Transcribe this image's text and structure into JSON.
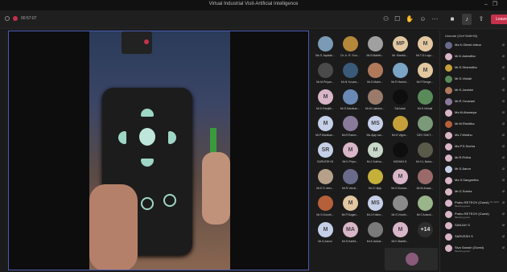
{
  "window": {
    "title": "Virtual Industrial Visit-Artificial Intelligence"
  },
  "toolbar": {
    "timer": "00:57:07",
    "leave_label": "Leave",
    "icons": [
      "people-icon",
      "chat-icon",
      "raise-hand-icon",
      "reactions-icon",
      "more-icon",
      "camera-icon",
      "mic-icon",
      "share-icon"
    ]
  },
  "grid": {
    "tiles": [
      {
        "name": "Ms.S.Jayalak...",
        "initials": "",
        "color": "#7a9ab5"
      },
      {
        "name": "Dr. A. R. Sou...",
        "initials": "",
        "color": "#b5873a"
      },
      {
        "name": "Mr.B.Babith...",
        "initials": "",
        "color": "#a0a0a0"
      },
      {
        "name": "Mr. Manick...",
        "initials": "MP",
        "color": "#e3c7a0"
      },
      {
        "name": "Mr.T.G.Logu...",
        "initials": "M",
        "color": "#e3c7a0"
      },
      {
        "name": "Mr.M.Priyan...",
        "initials": "",
        "color": "#4a4a4a"
      },
      {
        "name": "Mr.N.Yuvara...",
        "initials": "",
        "color": "#3a5a7a"
      },
      {
        "name": "Mr.S.Mahe...",
        "initials": "",
        "color": "#b07a5a"
      },
      {
        "name": "Mr.R.Harish...",
        "initials": "",
        "color": "#7aa5c5"
      },
      {
        "name": "Mr.P.Senge...",
        "initials": "M",
        "color": "#e3c7a0"
      },
      {
        "name": "Mr.K.Ranjith...",
        "initials": "M",
        "color": "#d9b5c8"
      },
      {
        "name": "Mr.S.Sasikum...",
        "initials": "",
        "color": "#6a8ab5"
      },
      {
        "name": "Mr.M.Lakshm...",
        "initials": "",
        "color": "#9a7a6a"
      },
      {
        "name": "Sai kalai",
        "initials": "",
        "color": "#0e0e0e"
      },
      {
        "name": "Mr.S.Vishali",
        "initials": "",
        "color": "#5a8a5a"
      },
      {
        "name": "Mr.P.Manikan...",
        "initials": "M",
        "color": "#c5d0e8"
      },
      {
        "name": "Mr.R.Rame...",
        "initials": "",
        "color": "#8a7a9a"
      },
      {
        "name": "Ms.Ajay sar...",
        "initials": "MS",
        "color": "#c5d0e8"
      },
      {
        "name": "Mr.G.Vigne...",
        "initials": "",
        "color": "#c5a03a"
      },
      {
        "name": "DEV SAKT...",
        "initials": "",
        "color": "#7a9a7a"
      },
      {
        "name": "SARVESH B",
        "initials": "SR",
        "color": "#c5d0e8"
      },
      {
        "name": "Mr.K.Priya...",
        "initials": "M",
        "color": "#d9b5c8"
      },
      {
        "name": "Mr.J.Subha...",
        "initials": "M",
        "color": "#c8d8c8"
      },
      {
        "name": "MOHAN S",
        "initials": "",
        "color": "#0e0e0e"
      },
      {
        "name": "Mr.V.L.Naha...",
        "initials": "",
        "color": "#5a5a4a"
      },
      {
        "name": "Mr.E.S.Jeev...",
        "initials": "",
        "color": "#b5a08a"
      },
      {
        "name": "Mr.R.Vimal...",
        "initials": "",
        "color": "#6a6a8a"
      },
      {
        "name": "Mr.G.Vijay",
        "initials": "",
        "color": "#c5b03a"
      },
      {
        "name": "Mr.G.Kumar...",
        "initials": "M",
        "color": "#d9b5c8"
      },
      {
        "name": "Mr.M.Arasa...",
        "initials": "",
        "color": "#9a6a6a"
      },
      {
        "name": "Mr.S.Gowth...",
        "initials": "",
        "color": "#b5603a"
      },
      {
        "name": "Mr.P.Sugan...",
        "initials": "M",
        "color": "#e3c7a0"
      },
      {
        "name": "Mr.J.Krishn...",
        "initials": "MS",
        "color": "#c5d0e8"
      },
      {
        "name": "Mr.S.Vinoth...",
        "initials": "",
        "color": "#8a8a8a"
      },
      {
        "name": "Mr.T.Anand...",
        "initials": "",
        "color": "#9ab58a"
      },
      {
        "name": "Mr.S.Aaron",
        "initials": "M",
        "color": "#c5d0e8"
      },
      {
        "name": "Mr.S.Karthi...",
        "initials": "MA",
        "color": "#d9b5c8"
      },
      {
        "name": "Mr.K.Ashwi...",
        "initials": "",
        "color": "#7a7a7a"
      },
      {
        "name": "Mr.K.Babith...",
        "initials": "M",
        "color": "#d9b5c8"
      },
      {
        "name": "+14",
        "initials": "+14",
        "color": "#2e2e2e"
      }
    ]
  },
  "panel": {
    "header": "Unmute (Ctrl+Shift+M)",
    "people": [
      {
        "name": "Ms.K.Gitesh kirtna",
        "status": "",
        "color": "#6a6a8a"
      },
      {
        "name": "Mr.K.Ashwitha",
        "status": "",
        "color": "#d9b5c8"
      },
      {
        "name": "Mr.S.Sharmitha",
        "status": "",
        "color": "#c5a03a"
      },
      {
        "name": "Mr.S.Vishali",
        "status": "",
        "color": "#5a8a5a"
      },
      {
        "name": "Mr.S.Jarshini",
        "status": "",
        "color": "#b07a5a"
      },
      {
        "name": "Mr.R.Yuvarani",
        "status": "",
        "color": "#8a7a9a"
      },
      {
        "name": "Ms.M.Aiswarya",
        "status": "",
        "color": "#d9b5c8"
      },
      {
        "name": "Mr.M.Rishitha",
        "status": "",
        "color": "#b5603a"
      },
      {
        "name": "Ms.T.Mridhu",
        "status": "",
        "color": "#d9b5c8"
      },
      {
        "name": "Ms.P.S.Sneha",
        "status": "",
        "color": "#d9b5c8"
      },
      {
        "name": "Mr.R.Pritha",
        "status": "",
        "color": "#d9b5c8"
      },
      {
        "name": "Mr.S.Aaron",
        "status": "",
        "color": "#c5d0e8"
      },
      {
        "name": "Ms.S.Sangeetha",
        "status": "",
        "color": "#d9b5c8"
      },
      {
        "name": "Mr.G.Sneha",
        "status": "",
        "color": "#d9b5c8"
      },
      {
        "name": "Prabu RETECH (Guest)",
        "status": "Meeting guest",
        "color": "#d9b5c8",
        "extra": "On hold"
      },
      {
        "name": "Prabu RETECH (Guest)",
        "status": "Meeting guest",
        "color": "#d9b5c8",
        "extra": ""
      },
      {
        "name": "SANJAY S",
        "status": "",
        "color": "#d9b5c8"
      },
      {
        "name": "SARVESH S",
        "status": "",
        "color": "#d9b5c8"
      },
      {
        "name": "Siva Sarash (Guest)",
        "status": "Meeting guest",
        "color": "#d9b5c8",
        "extra": ""
      }
    ]
  }
}
